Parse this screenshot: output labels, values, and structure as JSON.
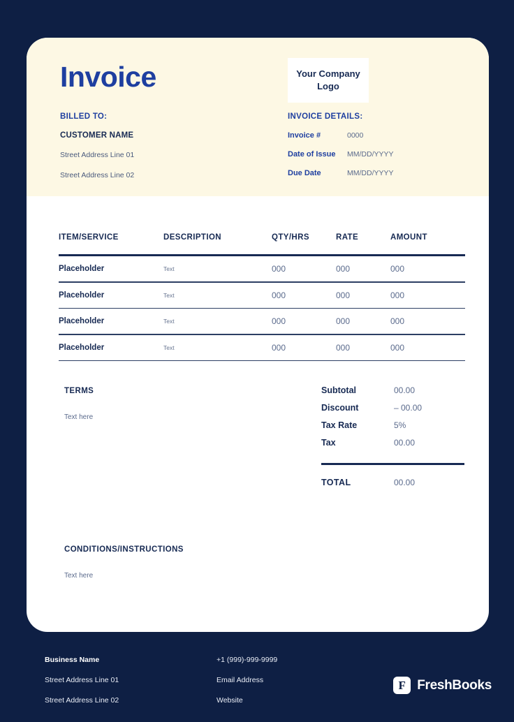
{
  "colors": {
    "page_background": "#0e1f44",
    "card_background": "#ffffff",
    "header_band": "#fdf8e4",
    "title_blue": "#1e3fa0",
    "navy_text": "#172a53",
    "muted_text": "#5a6a8c"
  },
  "header": {
    "title": "Invoice",
    "logo_placeholder": "Your Company Logo"
  },
  "billed_to": {
    "label": "BILLED TO:",
    "customer_name": "CUSTOMER NAME",
    "address_line_1": "Street Address Line 01",
    "address_line_2": "Street Address Line 02"
  },
  "invoice_details": {
    "label": "INVOICE DETAILS:",
    "rows": [
      {
        "key": "Invoice #",
        "value": "0000"
      },
      {
        "key": "Date of Issue",
        "value": "MM/DD/YYYY"
      },
      {
        "key": "Due Date",
        "value": "MM/DD/YYYY"
      }
    ]
  },
  "items_table": {
    "columns": [
      "ITEM/SERVICE",
      "DESCRIPTION",
      "QTY/HRS",
      "RATE",
      "AMOUNT"
    ],
    "rows": [
      {
        "item": "Placeholder",
        "description": "Text",
        "qty": "000",
        "rate": "000",
        "amount": "000"
      },
      {
        "item": "Placeholder",
        "description": "Text",
        "qty": "000",
        "rate": "000",
        "amount": "000"
      },
      {
        "item": "Placeholder",
        "description": "Text",
        "qty": "000",
        "rate": "000",
        "amount": "000"
      },
      {
        "item": "Placeholder",
        "description": "Text",
        "qty": "000",
        "rate": "000",
        "amount": "000"
      }
    ]
  },
  "terms": {
    "title": "TERMS",
    "text": "Text here"
  },
  "totals": {
    "rows": [
      {
        "key": "Subtotal",
        "value": "00.00"
      },
      {
        "key": "Discount",
        "value": "– 00.00"
      },
      {
        "key": "Tax Rate",
        "value": "5%"
      },
      {
        "key": "Tax",
        "value": "00.00"
      }
    ],
    "grand_key": "TOTAL",
    "grand_value": "00.00"
  },
  "conditions": {
    "title": "CONDITIONS/INSTRUCTIONS",
    "text": "Text here"
  },
  "footer": {
    "business_name": "Business Name",
    "address_line_1": "Street Address Line 01",
    "address_line_2": "Street Address Line 02",
    "phone": "+1 (999)-999-9999",
    "email": "Email Address",
    "website": "Website",
    "brand_mark": "F",
    "brand_name": "FreshBooks"
  }
}
